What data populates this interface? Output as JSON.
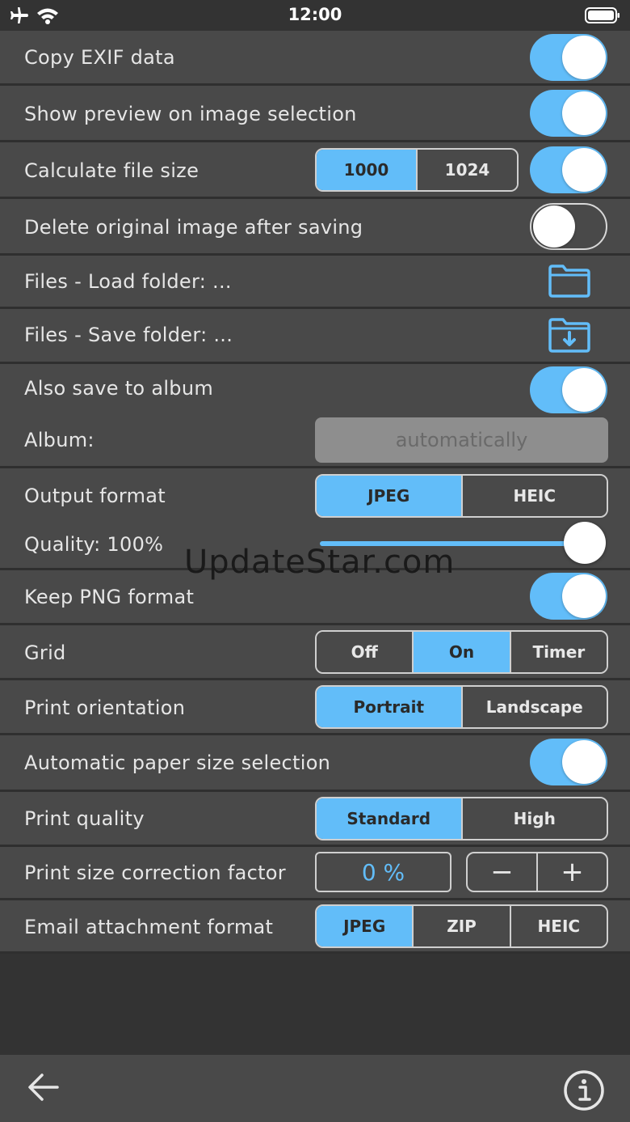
{
  "status_bar": {
    "time": "12:00",
    "icons": [
      "airplane-icon",
      "wifi-icon",
      "battery-icon"
    ]
  },
  "settings": {
    "copy_exif": {
      "label": "Copy EXIF data",
      "on": true
    },
    "show_preview": {
      "label": "Show preview on image selection",
      "on": true
    },
    "file_size": {
      "label": "Calculate file size",
      "options": [
        "1000",
        "1024"
      ],
      "selected": "1000",
      "on": true
    },
    "delete_original": {
      "label": "Delete original image after saving",
      "on": false
    },
    "load_folder": {
      "label": "Files - Load folder:  ...",
      "icon": "folder-icon"
    },
    "save_folder": {
      "label": "Files - Save folder:  ...",
      "icon": "folder-download-icon"
    },
    "save_album": {
      "label": "Also save to album",
      "on": true
    },
    "album": {
      "label": "Album:",
      "value": "automatically"
    },
    "output_format": {
      "label": "Output format",
      "options": [
        "JPEG",
        "HEIC"
      ],
      "selected": "JPEG"
    },
    "quality": {
      "label": "Quality: 100%",
      "value_percent": 100
    },
    "keep_png": {
      "label": "Keep PNG format",
      "on": true
    },
    "grid": {
      "label": "Grid",
      "options": [
        "Off",
        "On",
        "Timer"
      ],
      "selected": "On"
    },
    "print_orientation": {
      "label": "Print orientation",
      "options": [
        "Portrait",
        "Landscape"
      ],
      "selected": "Portrait"
    },
    "auto_paper": {
      "label": "Automatic paper size selection",
      "on": true
    },
    "print_quality": {
      "label": "Print quality",
      "options": [
        "Standard",
        "High"
      ],
      "selected": "Standard"
    },
    "size_correction": {
      "label": "Print size correction factor",
      "value": "0 %",
      "minus": "−",
      "plus": "+"
    },
    "email_format": {
      "label": "Email attachment format",
      "options": [
        "JPEG",
        "ZIP",
        "HEIC"
      ],
      "selected": "JPEG"
    }
  },
  "watermark": "UpdateStar.com",
  "bottom_bar": {
    "icons": [
      "back-arrow-icon",
      "info-icon"
    ]
  },
  "colors": {
    "accent": "#62bdf9",
    "row": "#494949",
    "background": "#333333"
  }
}
